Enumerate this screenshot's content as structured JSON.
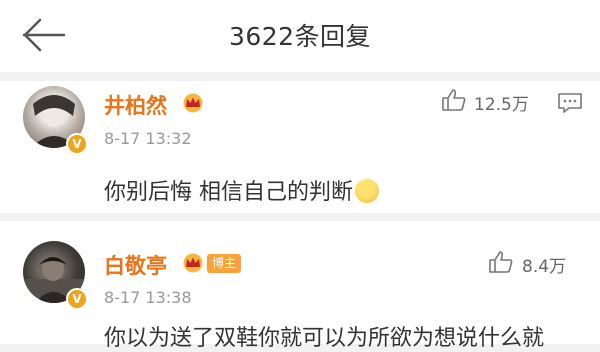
{
  "header": {
    "title": "3622条回复"
  },
  "comments": [
    {
      "username": "井柏然",
      "time": "8-17 13:32",
      "text": "你别后悔 相信自己的判断",
      "likes": "12.5万",
      "verified": true,
      "crown": true
    },
    {
      "username": "白敬亭",
      "tag": "博主",
      "time": "8-17 13:38",
      "text": "你以为送了双鞋你就可以为所欲为想说什么就",
      "likes": "8.4万",
      "verified": true,
      "crown": true
    }
  ],
  "colors": {
    "username": "#e8751a",
    "badge": "#f0a41c",
    "tag": "#f4a438",
    "time": "#999999",
    "background": "#f2f2f2"
  },
  "icons": [
    "back-arrow-icon",
    "crown-icon",
    "verified-v-icon",
    "thumbs-up-icon",
    "reply-icon",
    "emoji-shush-icon"
  ]
}
